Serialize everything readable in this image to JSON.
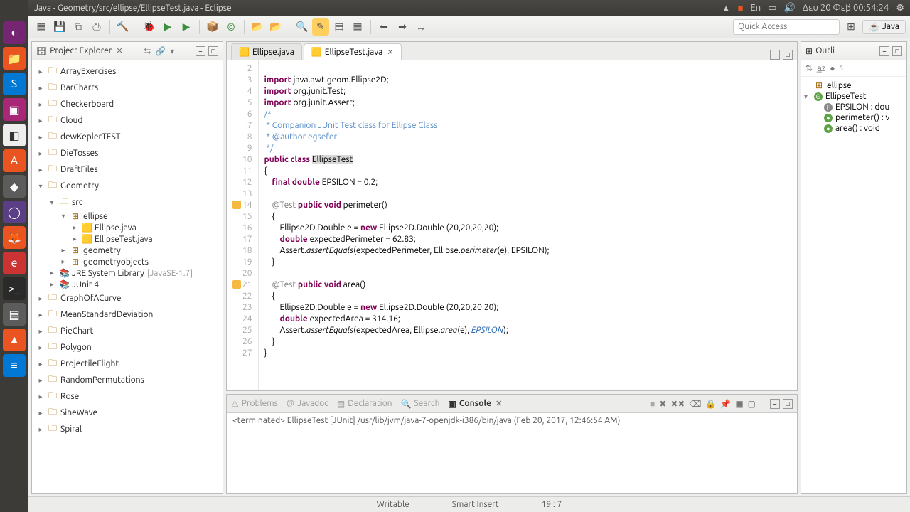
{
  "titlebar": {
    "title": "Java - Geometry/src/ellipse/EllipseTest.java - Eclipse",
    "clock": "Δευ 20 Φεβ 00:54:24"
  },
  "quick_access_placeholder": "Quick Access",
  "perspective_label": "Java",
  "project_explorer": {
    "title": "Project Explorer",
    "projects": [
      "ArrayExercises",
      "BarCharts",
      "Checkerboard",
      "Cloud",
      "dewKeplerTEST",
      "DieTosses",
      "DraftFiles"
    ],
    "geometry": {
      "name": "Geometry",
      "src": "src",
      "pkg_ellipse": "ellipse",
      "files": [
        "Ellipse.java",
        "EllipseTest.java"
      ],
      "pkg_geometry": "geometry",
      "pkg_geoobj": "geometryobjects",
      "jre": "JRE System Library",
      "jre_ver": "[JavaSE-1.7]",
      "junit": "JUnit 4"
    },
    "more": [
      "GraphOfACurve",
      "MeanStandardDeviation",
      "PieChart",
      "Polygon",
      "ProjectileFlight",
      "RandomPermutations",
      "Rose",
      "SineWave",
      "Spiral"
    ]
  },
  "editor": {
    "tabs": [
      "Ellipse.java",
      "EllipseTest.java"
    ],
    "active": 1,
    "lines": [
      {
        "n": 2,
        "t": ""
      },
      {
        "n": 3,
        "t": "<kw>import</kw> java.awt.geom.Ellipse2D;"
      },
      {
        "n": 4,
        "t": "<kw>import</kw> org.junit.Test;"
      },
      {
        "n": 5,
        "t": "<kw>import</kw> org.junit.Assert;"
      },
      {
        "n": 6,
        "t": "<cm>/*</cm>"
      },
      {
        "n": 7,
        "t": "<cm> * Companion JUnit Test class for Ellipse Class</cm>"
      },
      {
        "n": 8,
        "t": "<cm> * @author egseferi</cm>"
      },
      {
        "n": 9,
        "t": "<cm> */</cm>"
      },
      {
        "n": 10,
        "t": "<kw>public</kw> <kw>class</kw> <typ>EllipseTest</typ>"
      },
      {
        "n": 11,
        "t": "{"
      },
      {
        "n": 12,
        "t": "    <kw>final</kw> <kw>double</kw> EPSILON = 0.2;"
      },
      {
        "n": 13,
        "t": ""
      },
      {
        "n": 14,
        "t": "    <ann>@Test</ann> <kw>public</kw> <kw>void</kw> perimeter()",
        "warn": true
      },
      {
        "n": 15,
        "t": "    {"
      },
      {
        "n": 16,
        "t": "        Ellipse2D.Double e = <kw>new</kw> Ellipse2D.Double (20,20,20,20);"
      },
      {
        "n": 17,
        "t": "        <kw>double</kw> expectedPerimeter = 62.83;"
      },
      {
        "n": 18,
        "t": "        Assert.<mth>assertEquals</mth>(expectedPerimeter, Ellipse.<mth>perimeter</mth>(e), EPSILON);"
      },
      {
        "n": 19,
        "t": "    }"
      },
      {
        "n": 20,
        "t": ""
      },
      {
        "n": 21,
        "t": "    <ann>@Test</ann> <kw>public</kw> <kw>void</kw> area()",
        "warn": true
      },
      {
        "n": 22,
        "t": "    {"
      },
      {
        "n": 23,
        "t": "        Ellipse2D.Double e = <kw>new</kw> Ellipse2D.Double (20,20,20,20);"
      },
      {
        "n": 24,
        "t": "        <kw>double</kw> expectedArea = 314.16;"
      },
      {
        "n": 25,
        "t": "        Assert.<mth>assertEquals</mth>(expectedArea, Ellipse.<mth>area</mth>(e), <str>EPSILON</str>);"
      },
      {
        "n": 26,
        "t": "    }"
      },
      {
        "n": 27,
        "t": "}"
      }
    ]
  },
  "outline": {
    "title": "Outli",
    "pkg": "ellipse",
    "class": "EllipseTest",
    "members": [
      {
        "icon": "F",
        "label": "EPSILON : dou",
        "cls": "ot"
      },
      {
        "icon": "●",
        "label": "perimeter() : v",
        "cls": "og"
      },
      {
        "icon": "●",
        "label": "area() : void",
        "cls": "og"
      }
    ]
  },
  "console": {
    "tabs": [
      "Problems",
      "Javadoc",
      "Declaration",
      "Search",
      "Console"
    ],
    "active": 4,
    "text": "<terminated> EllipseTest [JUnit] /usr/lib/jvm/java-7-openjdk-i386/bin/java (Feb 20, 2017, 12:46:54 AM)"
  },
  "statusbar": {
    "writable": "Writable",
    "insert": "Smart Insert",
    "pos": "19 : 7"
  }
}
